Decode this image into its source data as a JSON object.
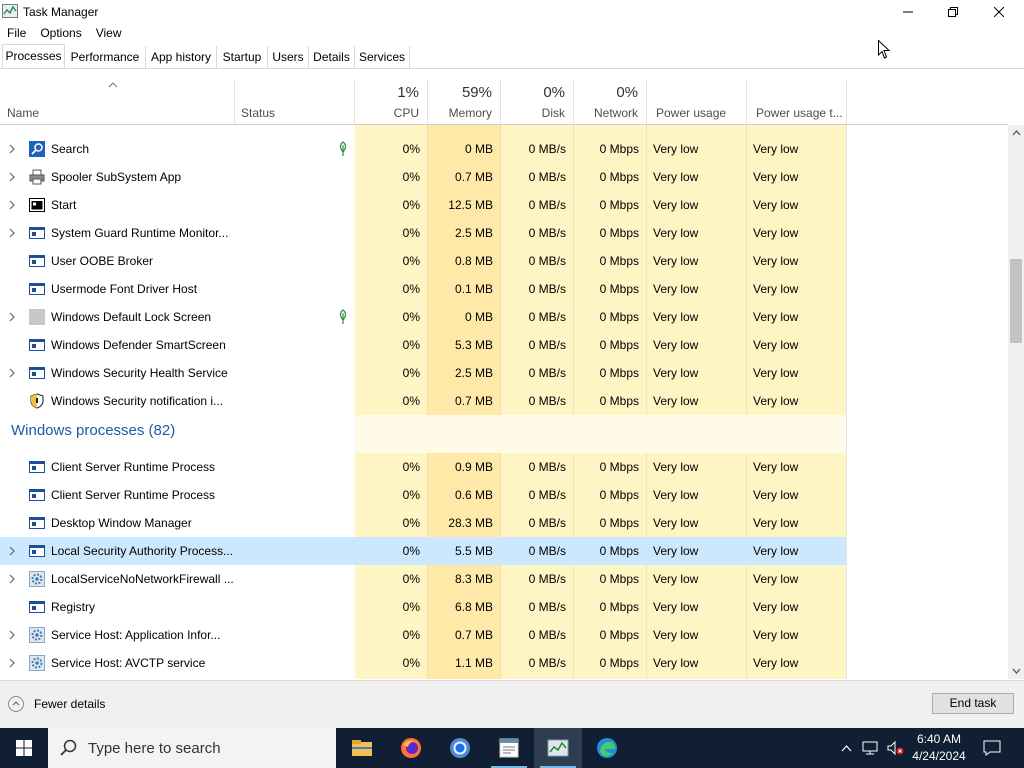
{
  "window": {
    "title": "Task Manager"
  },
  "menu": [
    "File",
    "Options",
    "View"
  ],
  "tabs": [
    "Processes",
    "Performance",
    "App history",
    "Startup",
    "Users",
    "Details",
    "Services"
  ],
  "columns": {
    "name": "Name",
    "status": "Status",
    "cpu": {
      "pct": "1%",
      "label": "CPU"
    },
    "memory": {
      "pct": "59%",
      "label": "Memory"
    },
    "disk": {
      "pct": "0%",
      "label": "Disk"
    },
    "network": {
      "pct": "0%",
      "label": "Network"
    },
    "power": "Power usage",
    "power_trend": "Power usage t..."
  },
  "rows_apps": [
    {
      "name": "Search",
      "icon": "search-app-icon",
      "expandable": true,
      "suspended": true,
      "cpu": "0%",
      "memory": "0 MB",
      "disk": "0 MB/s",
      "network": "0 Mbps",
      "power": "Very low",
      "power_trend": "Very low"
    },
    {
      "name": "Spooler SubSystem App",
      "icon": "printer-icon",
      "expandable": true,
      "suspended": false,
      "cpu": "0%",
      "memory": "0.7 MB",
      "disk": "0 MB/s",
      "network": "0 Mbps",
      "power": "Very low",
      "power_trend": "Very low"
    },
    {
      "name": "Start",
      "icon": "start-app-icon",
      "expandable": true,
      "suspended": false,
      "cpu": "0%",
      "memory": "12.5 MB",
      "disk": "0 MB/s",
      "network": "0 Mbps",
      "power": "Very low",
      "power_trend": "Very low"
    },
    {
      "name": "System Guard Runtime Monitor...",
      "icon": "window-app-icon",
      "expandable": true,
      "suspended": false,
      "cpu": "0%",
      "memory": "2.5 MB",
      "disk": "0 MB/s",
      "network": "0 Mbps",
      "power": "Very low",
      "power_trend": "Very low"
    },
    {
      "name": "User OOBE Broker",
      "icon": "window-app-icon",
      "expandable": false,
      "suspended": false,
      "cpu": "0%",
      "memory": "0.8 MB",
      "disk": "0 MB/s",
      "network": "0 Mbps",
      "power": "Very low",
      "power_trend": "Very low"
    },
    {
      "name": "Usermode Font Driver Host",
      "icon": "window-app-icon",
      "expandable": false,
      "suspended": false,
      "cpu": "0%",
      "memory": "0.1 MB",
      "disk": "0 MB/s",
      "network": "0 Mbps",
      "power": "Very low",
      "power_trend": "Very low"
    },
    {
      "name": "Windows Default Lock Screen",
      "icon": "lock-screen-icon",
      "expandable": true,
      "suspended": true,
      "cpu": "0%",
      "memory": "0 MB",
      "disk": "0 MB/s",
      "network": "0 Mbps",
      "power": "Very low",
      "power_trend": "Very low"
    },
    {
      "name": "Windows Defender SmartScreen",
      "icon": "window-app-icon",
      "expandable": false,
      "suspended": false,
      "cpu": "0%",
      "memory": "5.3 MB",
      "disk": "0 MB/s",
      "network": "0 Mbps",
      "power": "Very low",
      "power_trend": "Very low"
    },
    {
      "name": "Windows Security Health Service",
      "icon": "window-app-icon",
      "expandable": true,
      "suspended": false,
      "cpu": "0%",
      "memory": "2.5 MB",
      "disk": "0 MB/s",
      "network": "0 Mbps",
      "power": "Very low",
      "power_trend": "Very low"
    },
    {
      "name": "Windows Security notification i...",
      "icon": "shield-icon",
      "expandable": false,
      "suspended": false,
      "cpu": "0%",
      "memory": "0.7 MB",
      "disk": "0 MB/s",
      "network": "0 Mbps",
      "power": "Very low",
      "power_trend": "Very low"
    }
  ],
  "group_header": "Windows processes (82)",
  "rows_windows": [
    {
      "name": "Client Server Runtime Process",
      "icon": "window-app-icon",
      "expandable": false,
      "selected": false,
      "cpu": "0%",
      "memory": "0.9 MB",
      "disk": "0 MB/s",
      "network": "0 Mbps",
      "power": "Very low",
      "power_trend": "Very low"
    },
    {
      "name": "Client Server Runtime Process",
      "icon": "window-app-icon",
      "expandable": false,
      "selected": false,
      "cpu": "0%",
      "memory": "0.6 MB",
      "disk": "0 MB/s",
      "network": "0 Mbps",
      "power": "Very low",
      "power_trend": "Very low"
    },
    {
      "name": "Desktop Window Manager",
      "icon": "window-app-icon",
      "expandable": false,
      "selected": false,
      "cpu": "0%",
      "memory": "28.3 MB",
      "disk": "0 MB/s",
      "network": "0 Mbps",
      "power": "Very low",
      "power_trend": "Very low"
    },
    {
      "name": "Local Security Authority Process...",
      "icon": "window-app-icon",
      "expandable": true,
      "selected": true,
      "cpu": "0%",
      "memory": "5.5 MB",
      "disk": "0 MB/s",
      "network": "0 Mbps",
      "power": "Very low",
      "power_trend": "Very low"
    },
    {
      "name": "LocalServiceNoNetworkFirewall ...",
      "icon": "gear-icon",
      "expandable": true,
      "selected": false,
      "cpu": "0%",
      "memory": "8.3 MB",
      "disk": "0 MB/s",
      "network": "0 Mbps",
      "power": "Very low",
      "power_trend": "Very low"
    },
    {
      "name": "Registry",
      "icon": "window-app-icon",
      "expandable": false,
      "selected": false,
      "cpu": "0%",
      "memory": "6.8 MB",
      "disk": "0 MB/s",
      "network": "0 Mbps",
      "power": "Very low",
      "power_trend": "Very low"
    },
    {
      "name": "Service Host: Application Infor...",
      "icon": "gear-icon",
      "expandable": true,
      "selected": false,
      "cpu": "0%",
      "memory": "0.7 MB",
      "disk": "0 MB/s",
      "network": "0 Mbps",
      "power": "Very low",
      "power_trend": "Very low"
    },
    {
      "name": "Service Host: AVCTP service",
      "icon": "gear-icon",
      "expandable": true,
      "selected": false,
      "cpu": "0%",
      "memory": "1.1 MB",
      "disk": "0 MB/s",
      "network": "0 Mbps",
      "power": "Very low",
      "power_trend": "Very low"
    }
  ],
  "footer": {
    "fewer_details": "Fewer details",
    "end_task": "End task"
  },
  "taskbar": {
    "search_placeholder": "Type here to search",
    "apps": [
      "file-explorer-icon",
      "firefox-icon",
      "chrome-icon",
      "notepad-icon",
      "task-manager-icon",
      "edge-icon"
    ],
    "time": "6:40 AM",
    "date": "4/24/2024"
  },
  "colors": {
    "heat_light": "#fff4c4",
    "heat_mid": "#ffe9a8",
    "selected": "#cce8ff",
    "group_title": "#1c5aa6",
    "taskbar": "#101f33"
  }
}
